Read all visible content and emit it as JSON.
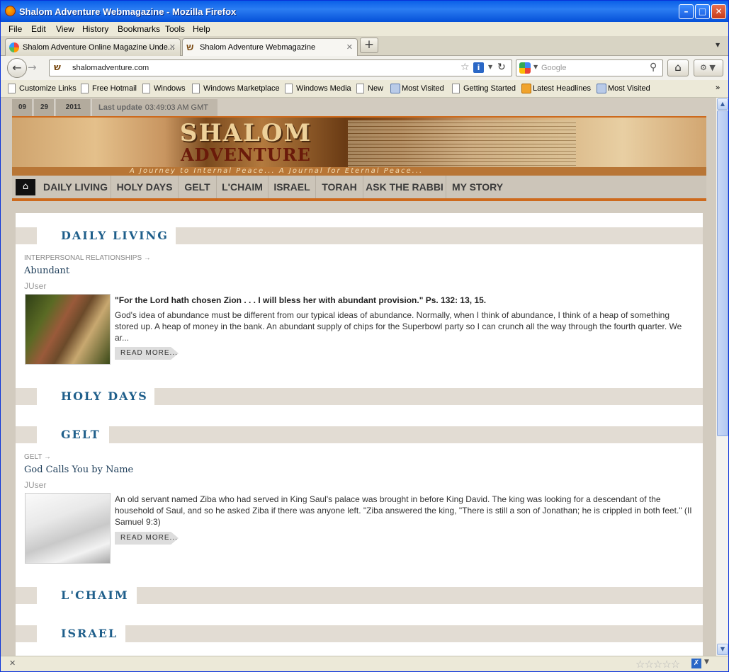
{
  "window": {
    "title": "Shalom Adventure Webmagazine - Mozilla Firefox"
  },
  "menu": [
    "File",
    "Edit",
    "View",
    "History",
    "Bookmarks",
    "Tools",
    "Help"
  ],
  "tabs": [
    {
      "label": "Shalom Adventure Online Magazine Unde...",
      "active": false
    },
    {
      "label": "Shalom Adventure Webmagazine",
      "active": true
    }
  ],
  "nav": {
    "url": "shalomadventure.com",
    "search_placeholder": "Google"
  },
  "bookmarks": [
    {
      "label": "Customize Links",
      "icon": "page-icon"
    },
    {
      "label": "Free Hotmail",
      "icon": "page-icon"
    },
    {
      "label": "Windows",
      "icon": "page-icon"
    },
    {
      "label": "Windows Marketplace",
      "icon": "page-icon"
    },
    {
      "label": "Windows Media",
      "icon": "page-icon"
    },
    {
      "label": "New",
      "icon": "page-icon"
    },
    {
      "label": "Most Visited",
      "icon": "most-visited-icon"
    },
    {
      "label": "Getting Started",
      "icon": "page-icon"
    },
    {
      "label": "Latest Headlines",
      "icon": "rss-icon"
    },
    {
      "label": "Most Visited",
      "icon": "most-visited-icon"
    }
  ],
  "site": {
    "date": {
      "month": "09",
      "day": "29",
      "year": "2011"
    },
    "last_update_label": "Last update",
    "last_update_time": "03:49:03 AM GMT",
    "logo_line1": "SHALOM",
    "logo_line2": "ADVENTURE",
    "tagline": "A Journey to Internal Peace...  A Journal for Eternal Peace...",
    "menu": [
      "DAILY LIVING",
      "HOLY DAYS",
      "GELT",
      "L'CHAIM",
      "ISRAEL",
      "TORAH",
      "ASK THE RABBI",
      "MY STORY"
    ]
  },
  "sections": [
    {
      "heading": "DAILY LIVING",
      "article": {
        "category": "INTERPERSONAL RELATIONSHIPS",
        "title": "Abundant",
        "author": "JUser",
        "lead": "\"For the Lord hath chosen Zion . . . I will bless her with abundant provision.\" Ps. 132: 13, 15.",
        "body": "God's idea of abundance must be different from our typical ideas of abundance. Normally, when I think of abundance, I think of a heap of something stored up. A heap of money in the bank. An abundant supply of chips for the Superbowl party so I can crunch all the way through the fourth quarter. We ar...",
        "read_more": "READ MORE..."
      }
    },
    {
      "heading": "HOLY DAYS"
    },
    {
      "heading": "GELT",
      "article": {
        "category": "GELT",
        "title": "God Calls You by Name",
        "author": "JUser",
        "body": "An old servant named Ziba who had served in King Saul's palace was brought in before King David. The king was looking for a descendant of the household of Saul, and so he asked Ziba if there was anyone left. \"Ziba answered the king, \"There is still a son of Jonathan; he is crippled in both feet.\" (II Samuel 9:3)",
        "read_more": "READ MORE..."
      }
    },
    {
      "heading": "L'CHAIM"
    },
    {
      "heading": "ISRAEL"
    }
  ]
}
